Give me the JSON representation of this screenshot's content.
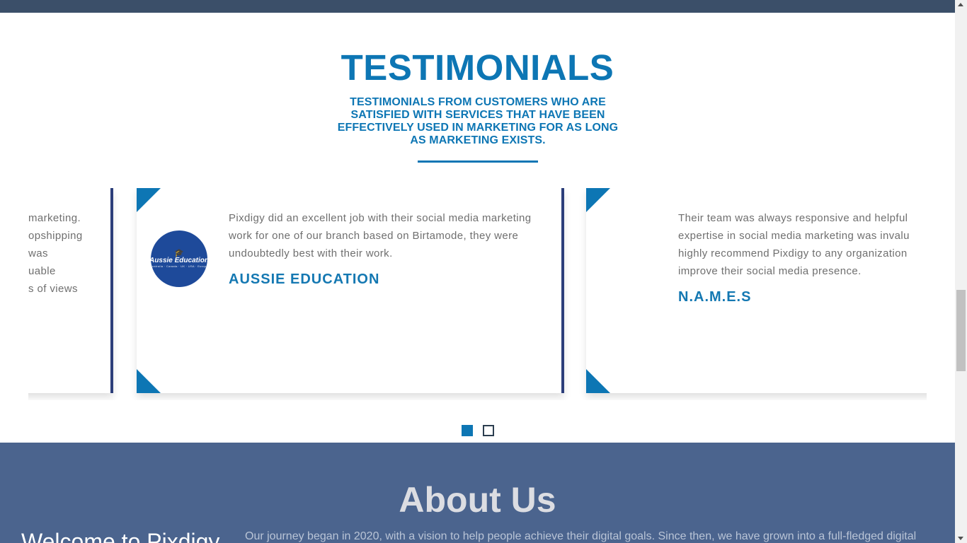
{
  "section": {
    "title": "TESTIMONIALS",
    "subtitle": "TESTIMONIALS FROM CUSTOMERS WHO ARE SATISFIED WITH SERVICES THAT HAVE BEEN EFFECTIVELY USED IN MARKETING FOR AS LONG AS MARKETING EXISTS."
  },
  "testimonials": [
    {
      "quote_lines": [
        "marketing.",
        "opshipping",
        "was",
        "uable",
        "s of views"
      ]
    },
    {
      "logo_text": "Aussie Education",
      "logo_tagline": "Australia · Canada · UK · USA · Europe",
      "quote": "Pixdigy did an excellent job with their social media marketing work for one of our branch based on Birtamode, they were undoubtedly best with their work.",
      "name": "AUSSIE EDUCATION"
    },
    {
      "quote": "Their team was always responsive and helpful expertise in social media marketing was invalu highly recommend Pixdigy to any organization improve their social media presence.",
      "name": "N.A.M.E.S"
    }
  ],
  "pagination": {
    "active_index": 0,
    "count": 2
  },
  "about": {
    "title": "About Us",
    "welcome": "Welcome to Pixdigy",
    "text": "Our journey began in 2020, with a vision to help people achieve their digital goals. Since then, we have grown into a full-fledged digital"
  },
  "colors": {
    "accent": "#0d76b4",
    "card_bar": "#2c3e7a",
    "about_bg": "#4b648e",
    "top_strip": "#3b4f69"
  }
}
